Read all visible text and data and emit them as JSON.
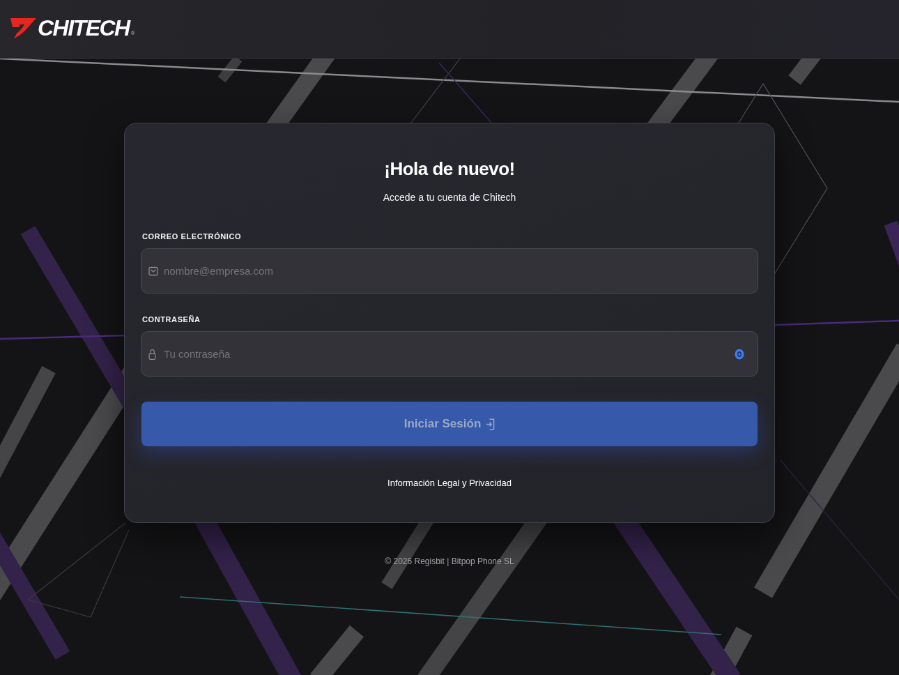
{
  "header": {
    "logo_text": "CHITECH",
    "logo_mark": "®"
  },
  "login_card": {
    "title": "¡Hola de nuevo!",
    "subtitle": "Accede a tu cuenta de Chitech",
    "fields": [
      {
        "kind": "email",
        "label": "CORREO ELECTRÓNICO",
        "placeholder": "nombre@empresa.com"
      },
      {
        "kind": "password",
        "label": "CONTRASEÑA",
        "placeholder": "Tu contraseña",
        "reveal_toggle": true
      }
    ],
    "submit_button": {
      "label": "Iniciar Sesión",
      "disabled": true
    },
    "legal_link": "Información Legal y Privacidad"
  },
  "footer": "© 2026 Regisbit | Bitpop Phone SL"
}
